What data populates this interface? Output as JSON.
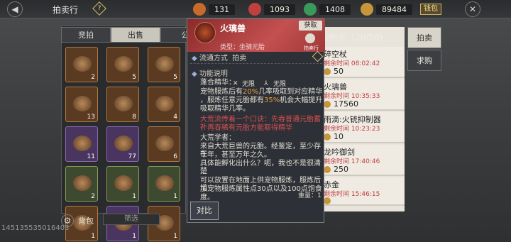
{
  "topbar": {
    "title": "拍卖行",
    "currencies": [
      {
        "name": "coin-a-icon",
        "value": "131",
        "color": "#c86a2a"
      },
      {
        "name": "coin-b-icon",
        "value": "1093",
        "color": "#c04040"
      },
      {
        "name": "jade-icon",
        "value": "1408",
        "color": "#3a9a5a"
      },
      {
        "name": "gold-icon",
        "value": "89484",
        "color": "#c8963a"
      }
    ],
    "charge_label": "钱包"
  },
  "tabs": [
    {
      "label": "竞拍",
      "active": false
    },
    {
      "label": "出售",
      "active": true
    },
    {
      "label": "公",
      "active": false
    }
  ],
  "grid": [
    {
      "qty": "2",
      "tone": "orange"
    },
    {
      "qty": "5",
      "tone": "orange"
    },
    {
      "qty": "5",
      "tone": "orange"
    },
    {
      "qty": "13",
      "tone": "orange"
    },
    {
      "qty": "8",
      "tone": "orange"
    },
    {
      "qty": "4",
      "tone": "orange"
    },
    {
      "qty": "11",
      "tone": "purple"
    },
    {
      "qty": "77",
      "tone": "purple"
    },
    {
      "qty": "6",
      "tone": "orange"
    },
    {
      "qty": "2",
      "tone": "green"
    },
    {
      "qty": "1",
      "tone": "green"
    },
    {
      "qty": "1",
      "tone": "green"
    },
    {
      "qty": "1",
      "tone": "orange"
    },
    {
      "qty": "1",
      "tone": "purple"
    },
    {
      "qty": "1",
      "tone": "orange"
    }
  ],
  "backpack": {
    "label": "背包",
    "filter": "筛选"
  },
  "uid": "145135535016403",
  "popup": {
    "name": "火璃兽",
    "type": "类型：坐骑元胎",
    "get_label": "获取",
    "auction_label": "拍卖行",
    "circulation_title": "流通方式",
    "circulation_value": "拍卖",
    "function_title": "功能说明",
    "refine_title": "蓬合精华：",
    "no_bind_1": "无限",
    "no_bind_2": "无限",
    "desc_1a": "宠物服炼后有",
    "desc_1b": "20%",
    "desc_1c": "几率吸取到对应精华",
    "desc_2a": "，服炼任意元胎都有",
    "desc_2b": "35%",
    "desc_2c": "机会大幅提升",
    "desc_3": "吸取精华几率。",
    "red_1": "大荒流传着一个口诀：先吞普通元胎蓄补",
    "red_2": "，再吞稀有元胎方能取得精华",
    "scholar_title": "大荒学者：",
    "scholar_1": "来自大荒巨兽的元胎。经鉴定，至少存在",
    "scholar_2": "千年，甚至万年之久。",
    "scholar_3": "具体能孵化出什么？呃，我也不是很清楚",
    "scholar_4": "...",
    "scholar_5": "可以放置在地面上供宠物服炼，服炼后增",
    "scholar_6": "加宠物服炼属性点30点以及100点饱食",
    "scholar_7": "度。",
    "weight": "重量：1",
    "compare_label": "对比"
  },
  "right": {
    "header": "架物品（20/20)",
    "listings": [
      {
        "name": "碎空杖",
        "time_label": "剩余时间",
        "time": "08:02:42",
        "price": "50"
      },
      {
        "name": "火璃兽",
        "time_label": "剩余时间",
        "time": "10:35:33",
        "price": "17560"
      },
      {
        "name": "雨滴:火铳抑制器",
        "time_label": "剩余时间",
        "time": "10:23:23",
        "price": "10"
      },
      {
        "name": "龙吟御剑",
        "time_label": "剩余时间",
        "time": "17:40:46",
        "price": "250"
      },
      {
        "name": "赤金",
        "time_label": "剩余时间",
        "time": "15:46:15",
        "price": ""
      }
    ]
  },
  "side_tabs": [
    {
      "label": "拍卖",
      "active": true
    },
    {
      "label": "求购",
      "active": false
    }
  ]
}
